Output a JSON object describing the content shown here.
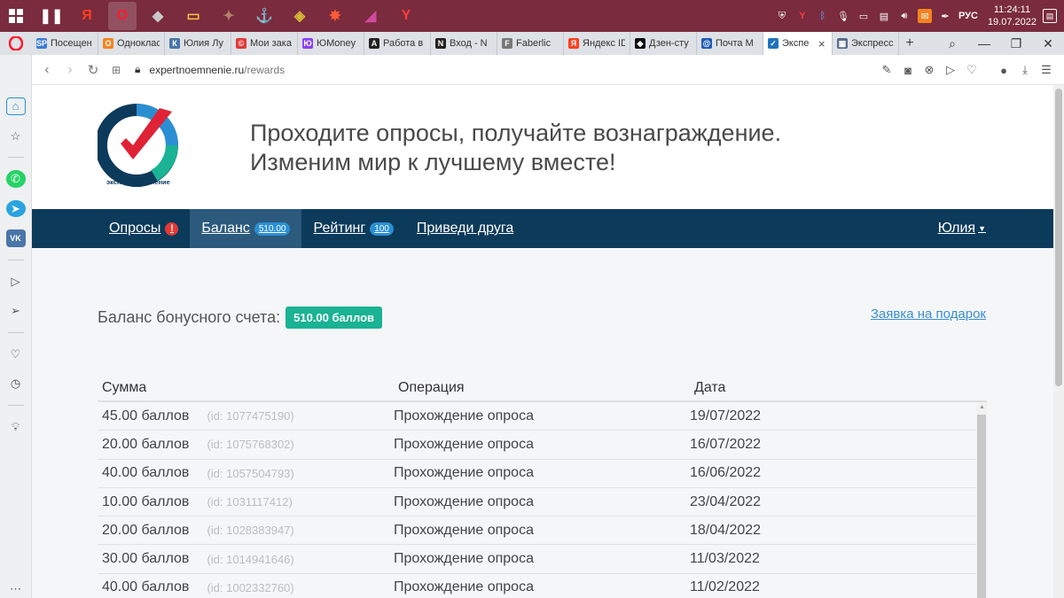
{
  "taskbar": {
    "apps": [
      {
        "name": "task-view",
        "glyph": "❚❚",
        "color": "#ffffff"
      },
      {
        "name": "yandex-app",
        "glyph": "Я",
        "color": "#fc3f1d"
      },
      {
        "name": "opera-app",
        "glyph": "O",
        "color": "#ff1b2d"
      },
      {
        "name": "tanks-app",
        "glyph": "◆",
        "color": "#c9c9c9"
      },
      {
        "name": "folder-app",
        "glyph": "▭",
        "color": "#f4c542"
      },
      {
        "name": "game-app-1",
        "glyph": "✦",
        "color": "#b57f6e"
      },
      {
        "name": "ship-app",
        "glyph": "⚓",
        "color": "#9bc0d9"
      },
      {
        "name": "game-app-2",
        "glyph": "◈",
        "color": "#d7b63a"
      },
      {
        "name": "game-app-3",
        "glyph": "✸",
        "color": "#ff5b3a"
      },
      {
        "name": "game-app-4",
        "glyph": "◢",
        "color": "#d04aa0"
      },
      {
        "name": "yandex-browser-app",
        "glyph": "Y",
        "color": "#ff3d3d"
      }
    ],
    "language": "РУС",
    "time": "11:24:11",
    "date": "19.07.2022"
  },
  "tabs": [
    {
      "label": "Посещен",
      "fav": "SP",
      "color": "#3d7bd9"
    },
    {
      "label": "Одноклас",
      "fav": "О",
      "color": "#f58220"
    },
    {
      "label": "Юлия Лу",
      "fav": "К",
      "color": "#4a76a8"
    },
    {
      "label": "Мои зака",
      "fav": "©",
      "color": "#e53935"
    },
    {
      "label": "ЮMoney",
      "fav": "Ю",
      "color": "#8b3ffd"
    },
    {
      "label": "Работа в",
      "fav": "A",
      "color": "#222222"
    },
    {
      "label": "Вход - N",
      "fav": "N",
      "color": "#222222"
    },
    {
      "label": "Faberlic",
      "fav": "F",
      "color": "#777777"
    },
    {
      "label": "Яндекс ID",
      "fav": "Я",
      "color": "#fc3f1d"
    },
    {
      "label": "Дзен-сту",
      "fav": "◆",
      "color": "#111111"
    },
    {
      "label": "Почта М",
      "fav": "@",
      "color": "#1e5bb8"
    },
    {
      "label": "Экспе",
      "fav": "✓",
      "color": "#1e73be",
      "active": true
    },
    {
      "label": "Экспресс",
      "fav": "▦",
      "color": "#5a6b8c"
    }
  ],
  "address": {
    "host": "expertnoemnenie.ru",
    "path": "/rewards"
  },
  "site": {
    "logo_text": "экспертное мнение",
    "tagline_line1": "Проходите опросы, получайте вознаграждение.",
    "tagline_line2": "Изменим мир к лучшему вместе!"
  },
  "nav": {
    "surveys": "Опросы",
    "surveys_alert": "!",
    "balance": "Баланс",
    "balance_badge": "510.00",
    "rating": "Рейтинг",
    "rating_badge": "100",
    "invite": "Приведи друга",
    "user": "Юлия"
  },
  "balance": {
    "label": "Баланс бонусного счета:",
    "value": "510.00 баллов",
    "gift_link": "Заявка на подарок"
  },
  "table": {
    "headers": [
      "Сумма",
      "Операция",
      "Дата"
    ],
    "rows": [
      {
        "amount": "45.00 баллов",
        "id": "(id: 1077475190)",
        "op": "Прохождение опроса",
        "date": "19/07/2022"
      },
      {
        "amount": "20.00 баллов",
        "id": "(id: 1075768302)",
        "op": "Прохождение опроса",
        "date": "16/07/2022"
      },
      {
        "amount": "40.00 баллов",
        "id": "(id: 1057504793)",
        "op": "Прохождение опроса",
        "date": "16/06/2022"
      },
      {
        "amount": "10.00 баллов",
        "id": "(id: 1031117412)",
        "op": "Прохождение опроса",
        "date": "23/04/2022"
      },
      {
        "amount": "20.00 баллов",
        "id": "(id: 1028383947)",
        "op": "Прохождение опроса",
        "date": "18/04/2022"
      },
      {
        "amount": "30.00 баллов",
        "id": "(id: 1014941646)",
        "op": "Прохождение опроса",
        "date": "11/03/2022"
      },
      {
        "amount": "40.00 баллов",
        "id": "(id: 1002332760)",
        "op": "Прохождение опроса",
        "date": "11/02/2022"
      }
    ]
  },
  "colors": {
    "navbar": "#0c3a5b",
    "balance_pill": "#1ab394",
    "link": "#3a8fcf",
    "taskbar": "#7a2b3d"
  }
}
